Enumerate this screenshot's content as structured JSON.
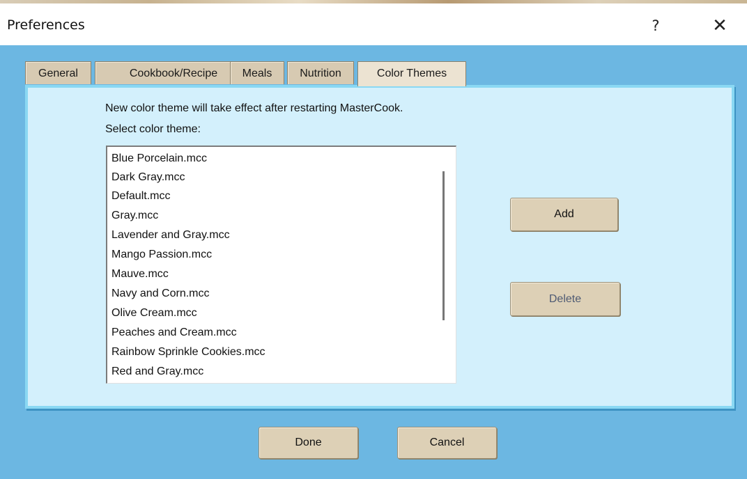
{
  "window": {
    "title": "Preferences",
    "help_label": "?",
    "close_label": "✕"
  },
  "tabs": [
    {
      "label": "General",
      "active": false
    },
    {
      "label": "Cookbook/Recipe",
      "active": false
    },
    {
      "label": "Meals",
      "active": false
    },
    {
      "label": "Nutrition",
      "active": false
    },
    {
      "label": "Color Themes",
      "active": true
    }
  ],
  "panel": {
    "info_text": "New color theme will take effect after restarting MasterCook.",
    "select_label": "Select color theme:",
    "themes": [
      "Blue Porcelain.mcc",
      "Dark Gray.mcc",
      "Default.mcc",
      "Gray.mcc",
      "Lavender and Gray.mcc",
      "Mango Passion.mcc",
      "Mauve.mcc",
      "Navy and Corn.mcc",
      "Olive Cream.mcc",
      "Peaches and Cream.mcc",
      "Rainbow Sprinkle Cookies.mcc",
      "Red and Gray.mcc"
    ],
    "add_label": "Add",
    "delete_label": "Delete"
  },
  "footer": {
    "done_label": "Done",
    "cancel_label": "Cancel"
  },
  "colors": {
    "dialog_background": "#6cb7e2",
    "panel_background": "#d3f0fc",
    "button_face": "#ddd0b6",
    "disabled_text": "#4e5a73"
  }
}
